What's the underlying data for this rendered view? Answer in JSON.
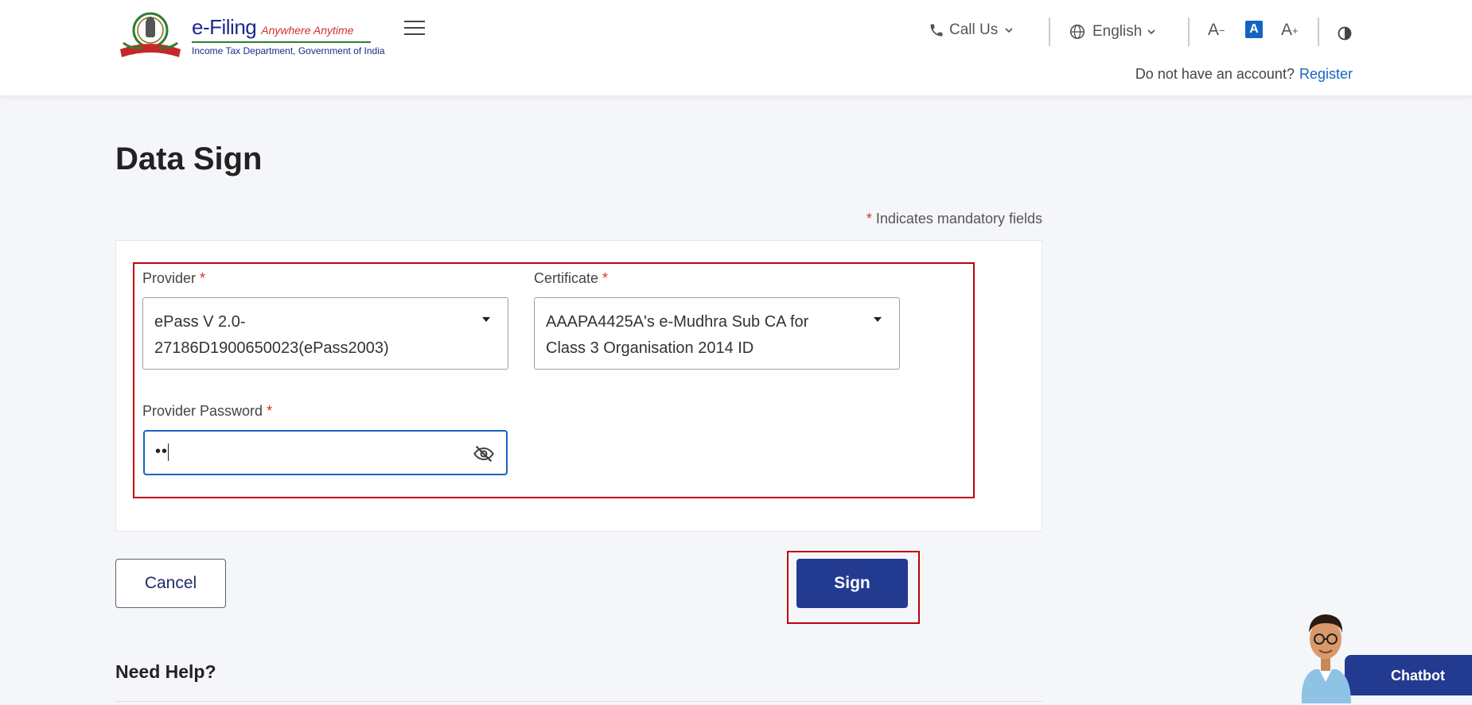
{
  "header": {
    "logo_title": "e-Filing",
    "logo_tagline": "Anywhere Anytime",
    "logo_subtitle": "Income Tax Department, Government of India",
    "call_us": "Call Us",
    "language": "English",
    "font_decrease": "A",
    "font_normal": "A",
    "font_increase": "A",
    "no_account_text": "Do not have an account?",
    "register_link": "Register"
  },
  "page": {
    "title": "Data Sign",
    "mandatory_note": "Indicates mandatory fields"
  },
  "form": {
    "provider_label": "Provider",
    "provider_value_line1": "ePass V 2.0-",
    "provider_value_line2": "27186D1900650023(ePass2003)",
    "certificate_label": "Certificate",
    "certificate_value_line1": "AAAPA4425A's e-Mudhra Sub CA for",
    "certificate_value_line2": "Class 3 Organisation 2014 ID",
    "password_label": "Provider Password",
    "password_value": "••"
  },
  "actions": {
    "cancel": "Cancel",
    "sign": "Sign"
  },
  "help": {
    "title": "Need Help?"
  },
  "chatbot": {
    "label": "Chatbot"
  },
  "icons": [
    "emblem-logo-icon",
    "hamburger-menu-icon",
    "phone-icon",
    "chevron-down-icon",
    "globe-icon",
    "font-decrease-icon",
    "font-normal-icon",
    "font-increase-icon",
    "contrast-icon",
    "eye-off-icon",
    "dropdown-caret-icon",
    "chatbot-avatar-icon"
  ],
  "colors": {
    "primary": "#233a91",
    "link": "#1565c0",
    "required": "#d32f2f",
    "highlight_box": "#c0000a",
    "page_background": "#f5f6fa"
  }
}
